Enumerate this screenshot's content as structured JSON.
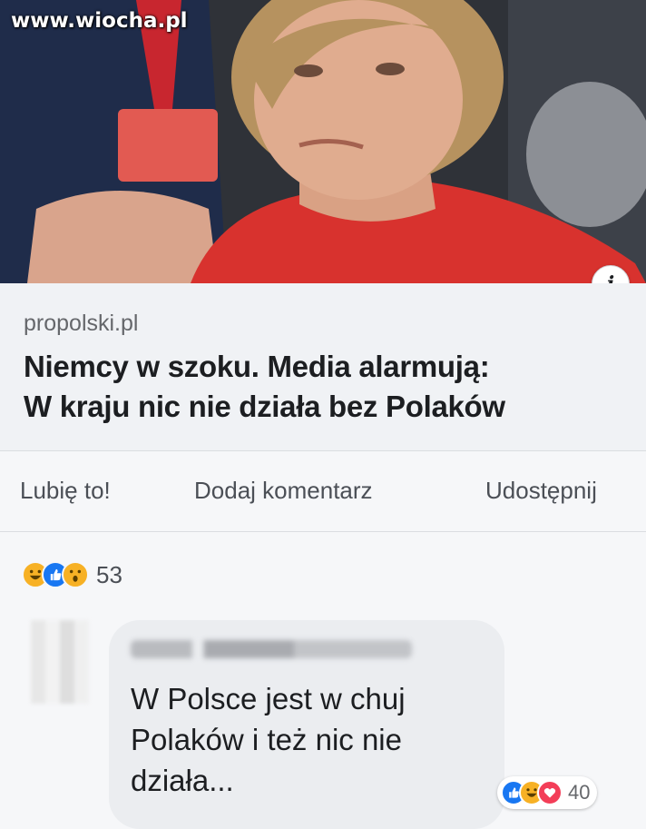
{
  "watermark": "www.wiocha.pl",
  "post": {
    "domain": "propolski.pl",
    "headline_line1": "Niemcy w szoku. Media alarmują:",
    "headline_line2": "W kraju nic nie działa bez Polaków",
    "info_label": "i"
  },
  "actions": {
    "like": "Lubię to!",
    "comment": "Dodaj komentarz",
    "share": "Udostępnij"
  },
  "reactions": {
    "icons": [
      "haha-icon",
      "like-icon",
      "wow-icon"
    ],
    "count": "53"
  },
  "comment": {
    "text_line1": "W Polsce jest w chuj",
    "text_line2": "Polaków i też nic nie",
    "text_line3": "działa...",
    "reactions": {
      "icons": [
        "like-icon",
        "haha-icon",
        "love-icon"
      ],
      "count": "40"
    }
  },
  "colors": {
    "like": "#1877f2",
    "haha": "#f7b125",
    "love": "#f33e58",
    "text_secondary": "#65676b"
  }
}
